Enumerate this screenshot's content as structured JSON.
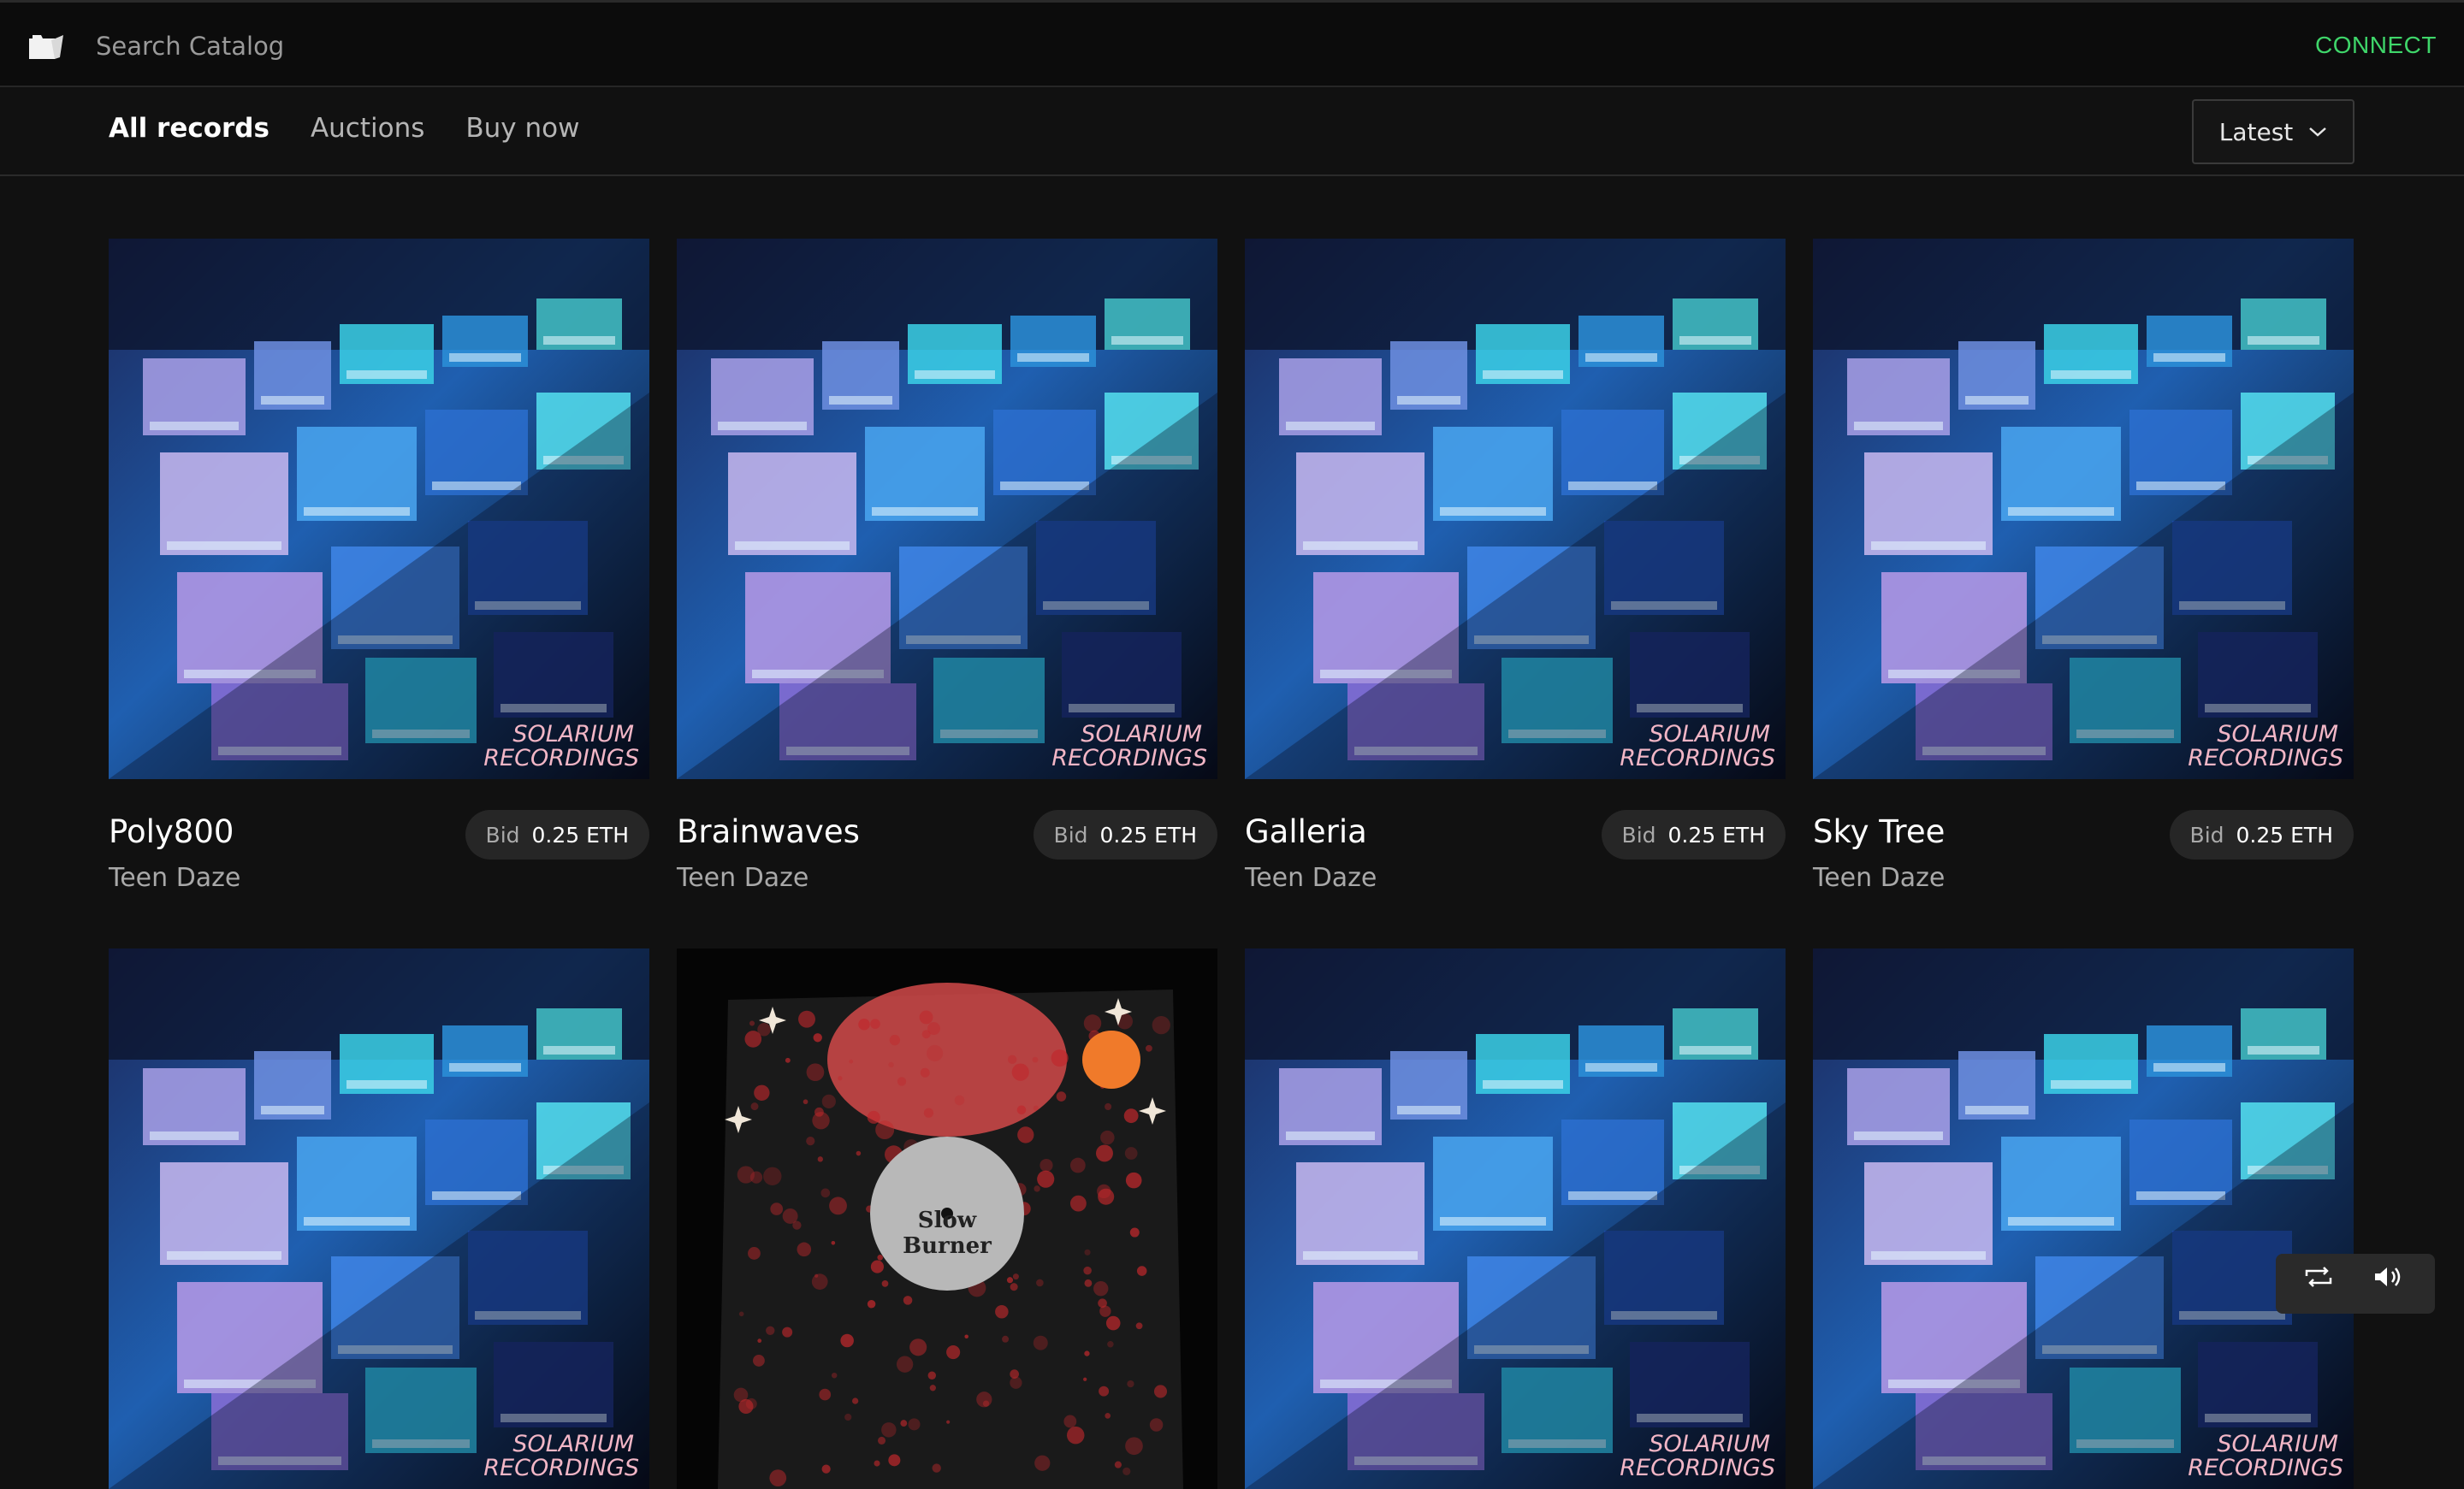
{
  "header": {
    "logo_icon": "wallet-folder-icon",
    "search_placeholder": "Search Catalog",
    "connect_label": "CONNECT",
    "connect_color": "#3fd66a"
  },
  "filters": {
    "tabs": [
      {
        "label": "All records",
        "active": true
      },
      {
        "label": "Auctions",
        "active": false
      },
      {
        "label": "Buy now",
        "active": false
      }
    ],
    "sort": {
      "selected": "Latest",
      "icon": "chevron-down-icon"
    }
  },
  "records": [
    {
      "title": "Poly800",
      "artist": "Teen Daze",
      "bid_label": "Bid",
      "price": "0.25 ETH",
      "cover": "city",
      "cover_text": [
        "SOLARIUM",
        "RECORDINGS"
      ]
    },
    {
      "title": "Brainwaves",
      "artist": "Teen Daze",
      "bid_label": "Bid",
      "price": "0.25 ETH",
      "cover": "city",
      "cover_text": [
        "SOLARIUM",
        "RECORDINGS"
      ]
    },
    {
      "title": "Galleria",
      "artist": "Teen Daze",
      "bid_label": "Bid",
      "price": "0.25 ETH",
      "cover": "city",
      "cover_text": [
        "SOLARIUM",
        "RECORDINGS"
      ]
    },
    {
      "title": "Sky Tree",
      "artist": "Teen Daze",
      "bid_label": "Bid",
      "price": "0.25 ETH",
      "cover": "city",
      "cover_text": [
        "SOLARIUM",
        "RECORDINGS"
      ]
    },
    {
      "cover": "city",
      "cover_text": [
        "SOLARIUM",
        "RECORDINGS"
      ]
    },
    {
      "cover": "record",
      "cover_text": [
        "Slow",
        "Burner"
      ]
    },
    {
      "cover": "city",
      "cover_text": [
        "SOLARIUM",
        "RECORDINGS"
      ]
    },
    {
      "cover": "city",
      "cover_text": [
        "SOLARIUM",
        "RECORDINGS"
      ]
    }
  ],
  "player": {
    "buttons": [
      "repeat-icon",
      "volume-icon"
    ]
  }
}
